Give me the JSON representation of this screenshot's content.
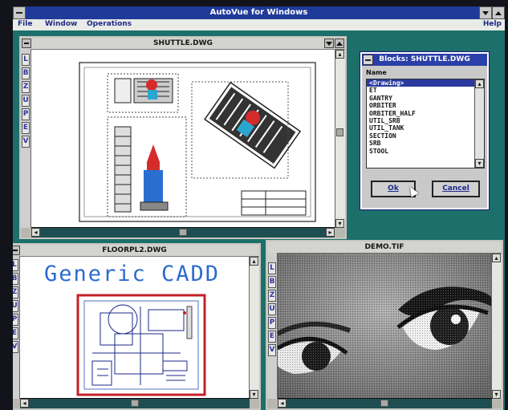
{
  "app": {
    "title": "AutoVue for Windows"
  },
  "menu": {
    "file": "File",
    "window": "Window",
    "operations": "Operations",
    "help": "Help"
  },
  "tool_letters": [
    "L",
    "B",
    "Z",
    "U",
    "P",
    "E",
    "V"
  ],
  "windows": {
    "shuttle": {
      "title": "SHUTTLE.DWG"
    },
    "floorpl": {
      "title": "FLOORPL2.DWG",
      "drawing_text": "Generic CADD"
    },
    "demo": {
      "title": "DEMO.TIF"
    }
  },
  "dialog": {
    "title": "Blocks: SHUTTLE.DWG",
    "name_label": "Name",
    "items": [
      "<Drawing>",
      "ET",
      "GANTRY",
      "ORBITER",
      "ORBITER_HALF",
      "UTIL_SRB",
      "UTIL_TANK",
      "SECTION",
      "SRB",
      "STOOL"
    ],
    "selected_index": 0,
    "ok_label": "Ok",
    "cancel_label": "Cancel"
  },
  "colors": {
    "desktop": "#1c6f6a",
    "active_title": "#2a3fa8",
    "app_title": "#203a9a"
  }
}
